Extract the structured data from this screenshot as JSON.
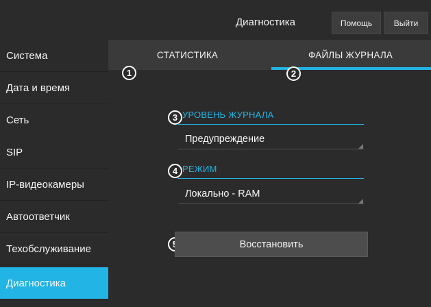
{
  "header": {
    "title": "Диагностика",
    "help_label": "Помощь",
    "logout_label": "Выйти"
  },
  "sidebar": {
    "items": [
      {
        "label": "Система"
      },
      {
        "label": "Дата и время"
      },
      {
        "label": "Сеть"
      },
      {
        "label": "SIP"
      },
      {
        "label": "IP-видеокамеры"
      },
      {
        "label": "Автоответчик"
      },
      {
        "label": "Техобслуживание"
      },
      {
        "label": "Диагностика",
        "active": true
      }
    ]
  },
  "tabs": [
    {
      "label": "СТАТИСТИКА"
    },
    {
      "label": "ФАЙЛЫ ЖУРНАЛА",
      "active": true
    }
  ],
  "callouts": [
    "1",
    "2",
    "3",
    "4",
    "5"
  ],
  "log_level": {
    "label": "УРОВЕНЬ ЖУРНАЛА",
    "value": "Предупреждение"
  },
  "mode": {
    "label": "РЕЖИМ",
    "value": "Локально - RAM"
  },
  "restore_label": "Восстановить",
  "colors": {
    "accent": "#22b4e4",
    "background": "#2b2b2b",
    "tabbar": "#3a3a3a",
    "button": "#4d4d4d"
  }
}
